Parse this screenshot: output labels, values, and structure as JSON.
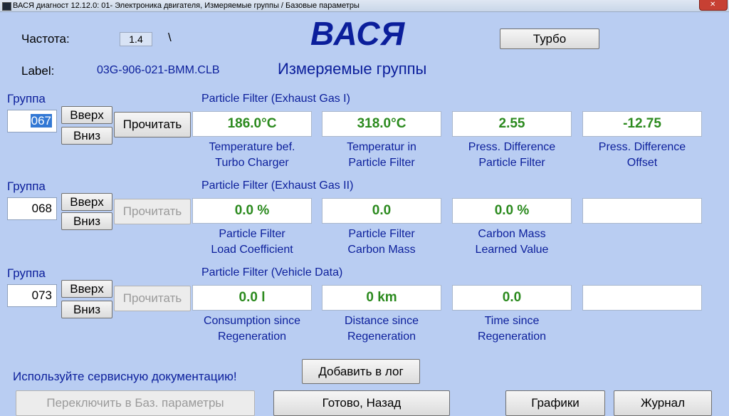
{
  "window": {
    "title": "ВАСЯ диагност 12.12.0: 01- Электроника двигателя,  Измеряемые группы / Базовые параметры"
  },
  "header": {
    "freq_label": "Частота:",
    "freq_value": "1.4",
    "freq_spinner": "\\",
    "label_label": "Label:",
    "label_value": "03G-906-021-BMM.CLB",
    "logo": "ВАСЯ",
    "subtitle": "Измеряемые группы",
    "turbo_button": "Турбо"
  },
  "groups": [
    {
      "label": "Группа",
      "number": "067",
      "up": "Вверх",
      "down": "Вниз",
      "read": "Прочитать",
      "title": "Particle Filter (Exhaust Gas I)",
      "fields": [
        {
          "value": "186.0°C",
          "caption1": "Temperature bef.",
          "caption2": "Turbo Charger"
        },
        {
          "value": "318.0°C",
          "caption1": "Temperatur in",
          "caption2": "Particle Filter"
        },
        {
          "value": "2.55",
          "caption1": "Press. Difference",
          "caption2": "Particle Filter"
        },
        {
          "value": "-12.75",
          "caption1": "Press. Difference",
          "caption2": "Offset"
        }
      ]
    },
    {
      "label": "Группа",
      "number": "068",
      "up": "Вверх",
      "down": "Вниз",
      "read": "Прочитать",
      "title": "Particle Filter (Exhaust Gas II)",
      "fields": [
        {
          "value": "0.0 %",
          "caption1": "Particle Filter",
          "caption2": "Load Coefficient"
        },
        {
          "value": "0.0",
          "caption1": "Particle Filter",
          "caption2": "Carbon Mass"
        },
        {
          "value": "0.0 %",
          "caption1": "Carbon Mass",
          "caption2": "Learned Value"
        },
        {
          "value": "",
          "caption1": "",
          "caption2": ""
        }
      ]
    },
    {
      "label": "Группа",
      "number": "073",
      "up": "Вверх",
      "down": "Вниз",
      "read": "Прочитать",
      "title": "Particle Filter (Vehicle Data)",
      "fields": [
        {
          "value": "0.0 l",
          "caption1": "Consumption since",
          "caption2": "Regeneration"
        },
        {
          "value": "0 km",
          "caption1": "Distance since",
          "caption2": "Regeneration"
        },
        {
          "value": "0.0",
          "caption1": "Time since",
          "caption2": "Regeneration"
        },
        {
          "value": "",
          "caption1": "",
          "caption2": ""
        }
      ]
    }
  ],
  "footer": {
    "notice": "Используйте сервисную документацию!",
    "add_log": "Добавить в лог",
    "switch_basic": "Переключить в Баз. параметры",
    "done_back": "Готово, Назад",
    "graphs": "Графики",
    "journal": "Журнал"
  },
  "colors": {
    "background": "#b9cdf2",
    "accent": "#0b1e9b",
    "value_green": "#2b8a1e"
  }
}
